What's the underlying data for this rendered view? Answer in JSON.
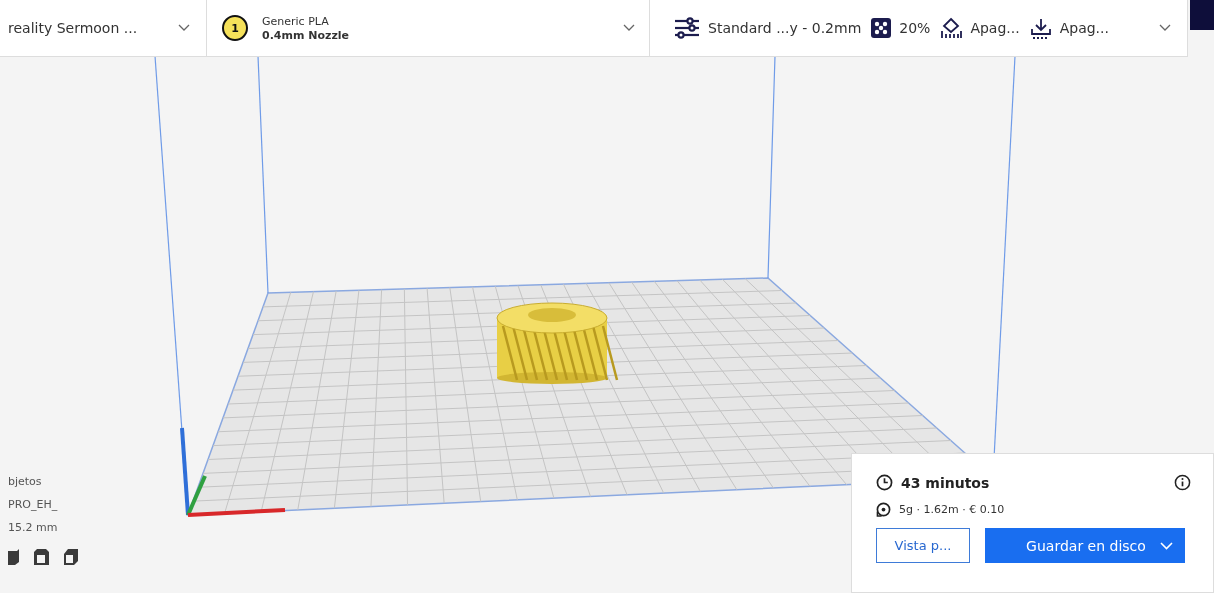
{
  "printer": {
    "name": "reality Sermoon ..."
  },
  "extruder": {
    "number": "1",
    "material": "Generic PLA",
    "nozzle": "0.4mm Nozzle"
  },
  "print_settings": {
    "profile": "Standard ...y - 0.2mm",
    "infill": "20%",
    "support": "Apag...",
    "adhesion": "Apag..."
  },
  "object_info": {
    "lines": [
      "bjetos",
      "PRO_EH_",
      "15.2 mm"
    ]
  },
  "estimate": {
    "time": "43 minutos",
    "material": "5g · 1.62m · € 0.10"
  },
  "actions": {
    "preview": "Vista p...",
    "save": "Guardar en disco"
  }
}
